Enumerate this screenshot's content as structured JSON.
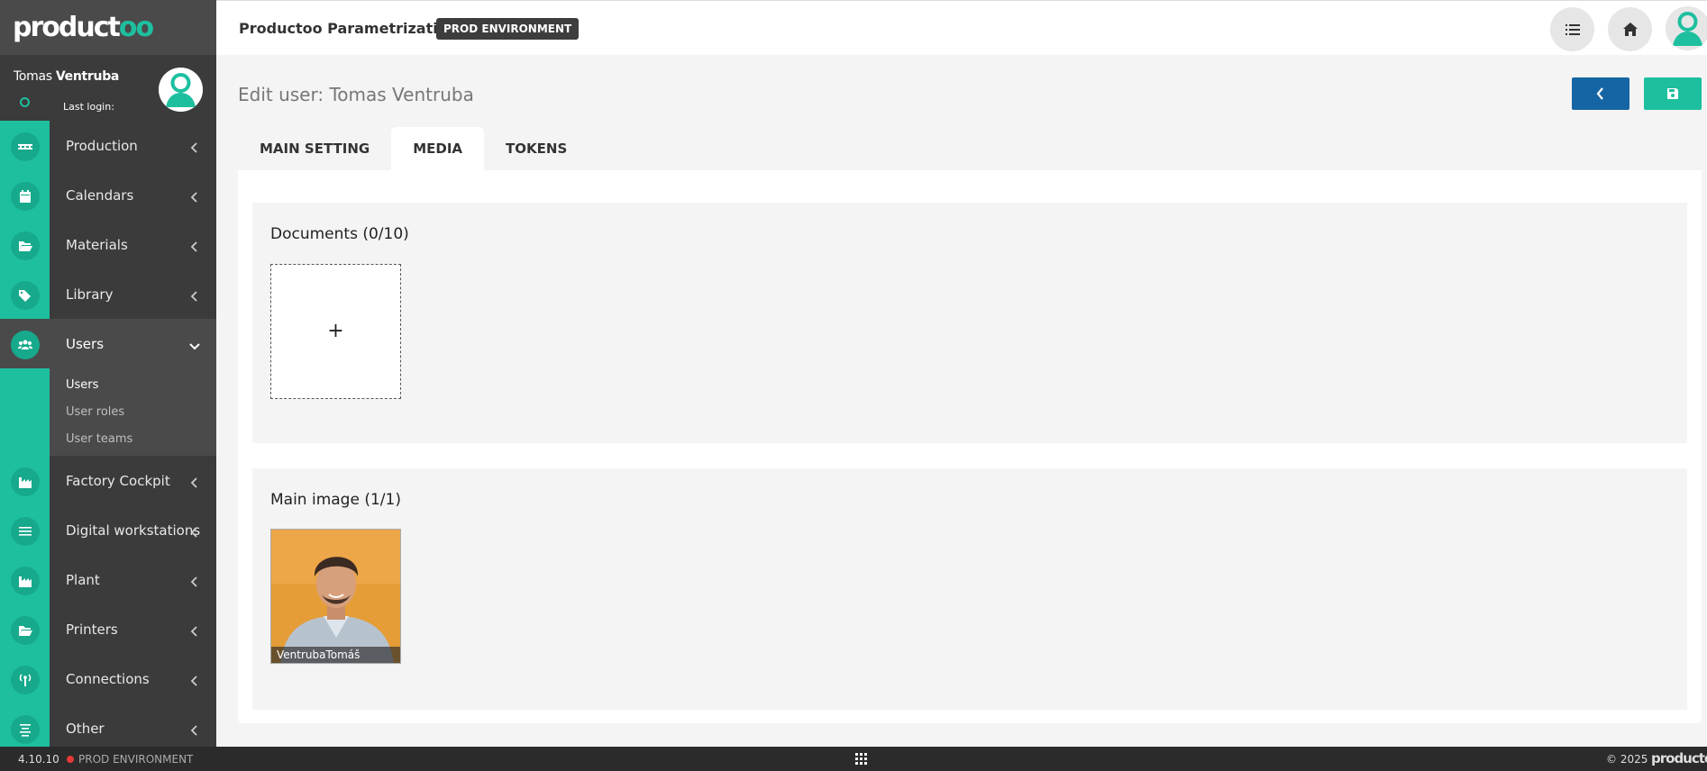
{
  "brand": {
    "logo_main": "product",
    "logo_accent": "oo"
  },
  "user": {
    "first_name": "Tomas",
    "last_name": "Ventruba",
    "last_login_label": "Last login:"
  },
  "header": {
    "title": "Productoo Parametrization",
    "env_badge": "PROD ENVIRONMENT"
  },
  "menu": {
    "items": [
      {
        "label": "Production",
        "icon": "conveyor-icon"
      },
      {
        "label": "Calendars",
        "icon": "calendar-icon"
      },
      {
        "label": "Materials",
        "icon": "folder-open-icon"
      },
      {
        "label": "Library",
        "icon": "tags-icon"
      },
      {
        "label": "Users",
        "icon": "users-icon"
      },
      {
        "label": "Factory Cockpit",
        "icon": "factory-icon"
      },
      {
        "label": "Digital workstations",
        "icon": "list-icon"
      },
      {
        "label": "Plant",
        "icon": "factory-icon"
      },
      {
        "label": "Printers",
        "icon": "folder-open-icon"
      },
      {
        "label": "Connections",
        "icon": "antenna-icon"
      },
      {
        "label": "Other",
        "icon": "align-center-icon"
      }
    ],
    "users_submenu": [
      "Users",
      "User roles",
      "User teams"
    ]
  },
  "page": {
    "title": "Edit user: Tomas Ventruba",
    "tabs": [
      "MAIN SETTING",
      "MEDIA",
      "TOKENS"
    ],
    "active_tab": "MEDIA"
  },
  "media": {
    "documents": {
      "title": "Documents (0/10)",
      "add_symbol": "+"
    },
    "main_image": {
      "title": "Main image (1/1)",
      "caption": "VentrubaTomáš"
    }
  },
  "footer": {
    "version": "4.10.10",
    "env": "PROD ENVIRONMENT",
    "copyright": "© 2025",
    "logo": "productoo"
  },
  "colors": {
    "accent": "#1dbf9f",
    "sidebar": "#3b3b3b",
    "back_button": "#1565a4",
    "footer": "#2b2b2b"
  }
}
